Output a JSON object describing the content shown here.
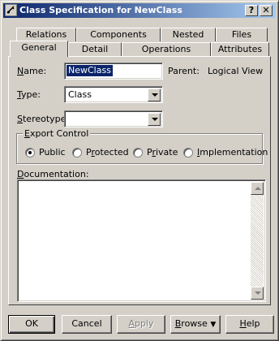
{
  "window": {
    "title": "Class Specification for NewClass"
  },
  "titlebar": {
    "help_label": "?",
    "close_label": "✕"
  },
  "tabs_back": [
    "Relations",
    "Components",
    "Nested",
    "Files"
  ],
  "tabs_front": [
    "General",
    "Detail",
    "Operations",
    "Attributes"
  ],
  "active_tab": "General",
  "form": {
    "name_label": "Name:",
    "name_value": "NewClass",
    "parent_label": "Parent:",
    "parent_value": "Logical View",
    "type_label": "Type:",
    "type_value": "Class",
    "stereotype_label": "Stereotype:",
    "stereotype_value": ""
  },
  "export_control": {
    "label": "Export Control",
    "options": [
      "Public",
      "Protected",
      "Private",
      "Implementation"
    ],
    "selected": "Public"
  },
  "documentation": {
    "label": "Documentation:",
    "value": ""
  },
  "buttons": {
    "ok": "OK",
    "cancel": "Cancel",
    "apply": "Apply",
    "browse": "Browse",
    "browse_arrow": "▼",
    "help": "Help"
  },
  "colors": {
    "titlebar_start": "#0a246a",
    "titlebar_end": "#a6caf0",
    "face": "#d4d0c8",
    "selection": "#0a246a"
  }
}
